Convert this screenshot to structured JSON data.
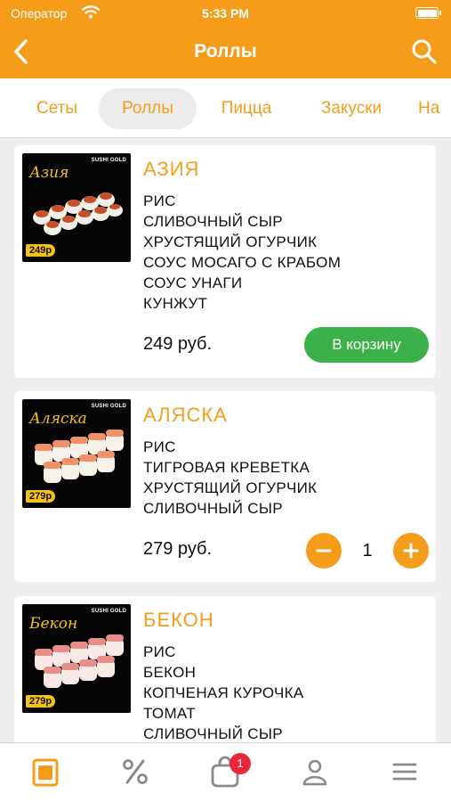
{
  "status_bar": {
    "carrier": "Оператор",
    "time": "5:33 PM"
  },
  "nav": {
    "title": "Роллы",
    "back_icon": "chevron-left-icon",
    "search_icon": "search-icon"
  },
  "categories": [
    {
      "label": "Сеты",
      "active": false
    },
    {
      "label": "Роллы",
      "active": true
    },
    {
      "label": "Пицца",
      "active": false
    },
    {
      "label": "Закуски",
      "active": false
    },
    {
      "label": "На",
      "active": false
    }
  ],
  "products": [
    {
      "name": "АЗИЯ",
      "image_script": "Азия",
      "image_brand": "SUSHI GOLD",
      "image_price": "249р",
      "ingredients": [
        "РИС",
        "СЛИВОЧНЫЙ СЫР",
        "ХРУСТЯЩИЙ ОГУРЧИК",
        "СОУС МОСАГО С КРАБОМ",
        "СОУС УНАГИ",
        "КУНЖУТ"
      ],
      "price": "249 руб.",
      "cart_label": "В корзину"
    },
    {
      "name": "АЛЯСКА",
      "image_script": "Аляска",
      "image_brand": "SUSHI GOLD",
      "image_price": "279р",
      "ingredients": [
        "РИС",
        "ТИГРОВАЯ КРЕВЕТКА",
        "ХРУСТЯЩИЙ ОГУРЧИК",
        "СЛИВОЧНЫЙ СЫР"
      ],
      "price": "279 руб.",
      "quantity": "1"
    },
    {
      "name": "БЕКОН",
      "image_script": "Бекон",
      "image_brand": "SUSHI GOLD",
      "image_price": "279р",
      "ingredients": [
        "РИС",
        "БЕКОН",
        "КОПЧЕНАЯ КУРОЧКА",
        "ТОМАТ",
        "СЛИВОЧНЫЙ СЫР"
      ]
    }
  ],
  "tab_bar": {
    "items": [
      "menu-icon",
      "percent-icon",
      "cart-icon",
      "profile-icon",
      "hamburger-icon"
    ],
    "cart_badge": "1"
  },
  "colors": {
    "accent": "#f59c1b",
    "cart_button": "#3cb14a",
    "badge": "#e8273b"
  }
}
